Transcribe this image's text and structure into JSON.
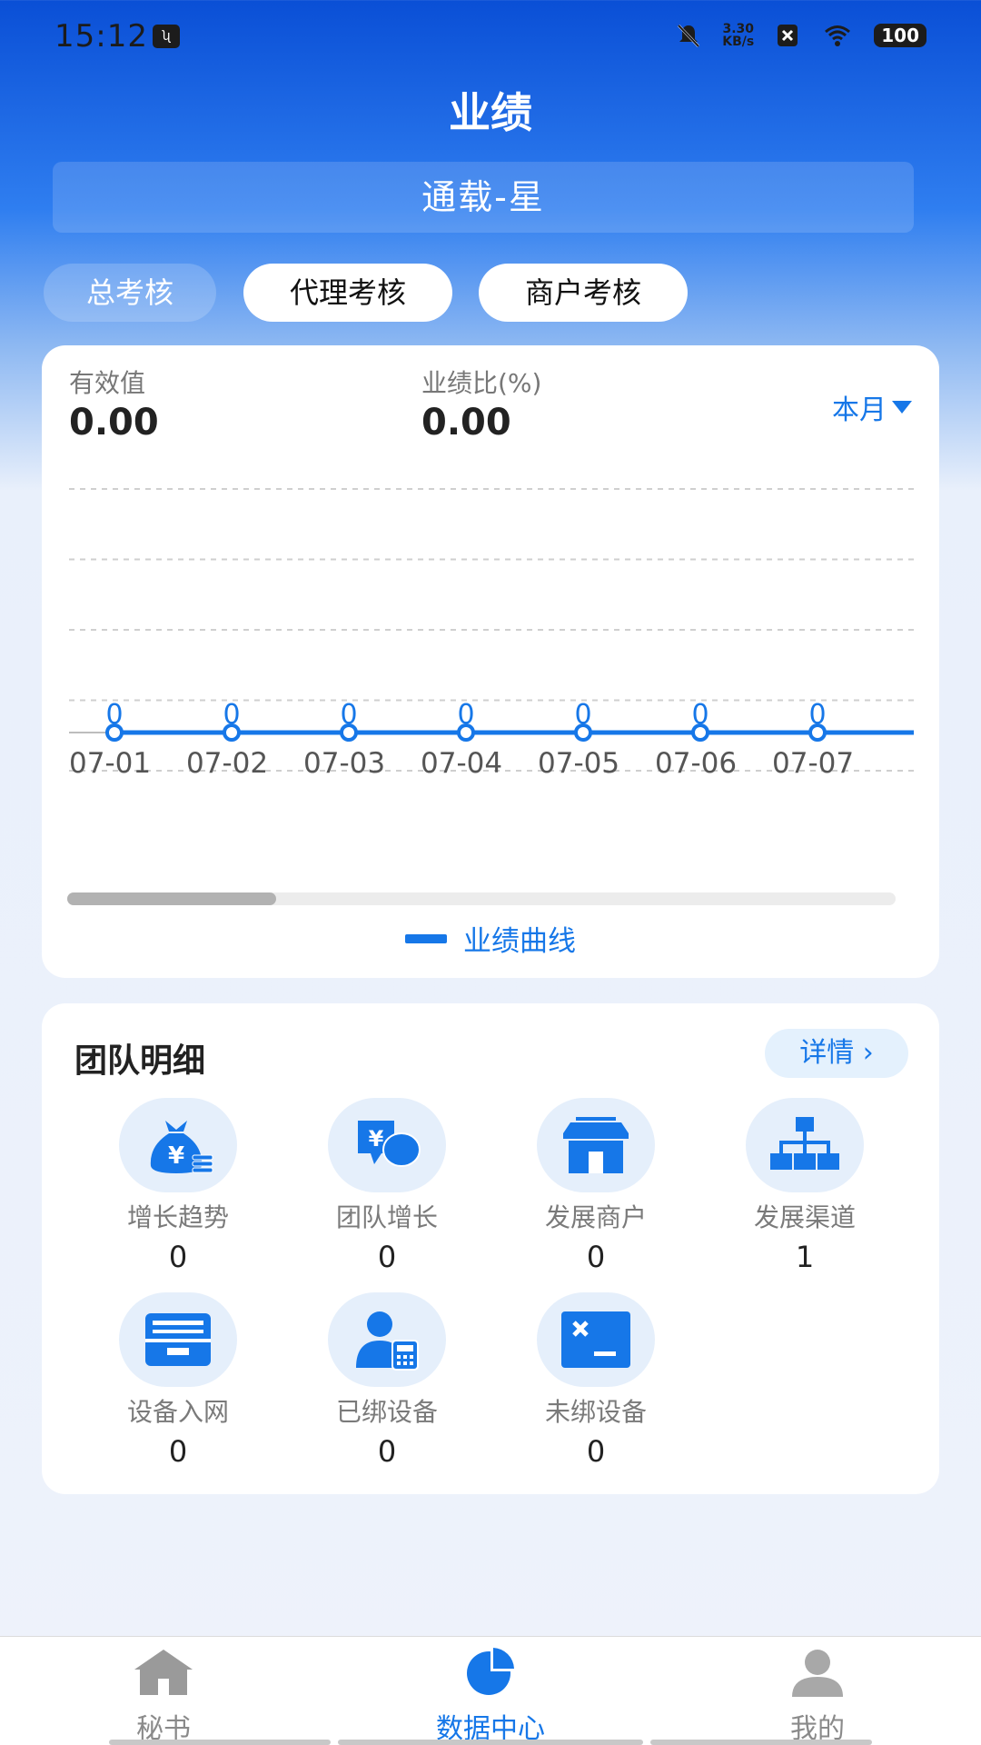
{
  "status_bar": {
    "time": "15:12",
    "net_speed_value": "3.30",
    "net_speed_unit": "KB/s",
    "battery": "100"
  },
  "header": {
    "title": "业绩",
    "agent_name": "通载-星"
  },
  "tabs": [
    {
      "label": "总考核",
      "active": true
    },
    {
      "label": "代理考核",
      "active": false
    },
    {
      "label": "商户考核",
      "active": false
    }
  ],
  "summary": {
    "metric1_label": "有效值",
    "metric1_value": "0.00",
    "metric2_label": "业绩比(%)",
    "metric2_value": "0.00",
    "period_label": "本月"
  },
  "chart_data": {
    "type": "line",
    "categories": [
      "07-01",
      "07-02",
      "07-03",
      "07-04",
      "07-05",
      "07-06",
      "07-07"
    ],
    "series": [
      {
        "name": "业绩曲线",
        "values": [
          0,
          0,
          0,
          0,
          0,
          0,
          0
        ]
      }
    ],
    "grid": true,
    "legend_position": "bottom",
    "line_color": "#1677e8"
  },
  "team": {
    "title": "团队明细",
    "detail_label": "详情",
    "items": [
      {
        "label": "增长趋势",
        "value": "0",
        "icon": "money-bag-icon"
      },
      {
        "label": "团队增长",
        "value": "0",
        "icon": "yuan-chat-icon"
      },
      {
        "label": "发展商户",
        "value": "0",
        "icon": "store-icon"
      },
      {
        "label": "发展渠道",
        "value": "1",
        "icon": "org-chart-icon"
      },
      {
        "label": "设备入网",
        "value": "0",
        "icon": "inbox-icon"
      },
      {
        "label": "已绑设备",
        "value": "0",
        "icon": "user-pos-icon"
      },
      {
        "label": "未绑设备",
        "value": "0",
        "icon": "terminal-unbind-icon"
      }
    ]
  },
  "nav": [
    {
      "label": "秘书",
      "icon": "home-icon",
      "active": false
    },
    {
      "label": "数据中心",
      "icon": "pie-chart-icon",
      "active": true
    },
    {
      "label": "我的",
      "icon": "user-icon",
      "active": false
    }
  ],
  "colors": {
    "accent": "#1677e8",
    "icon_bg": "#e5effb",
    "nav_inactive": "#9a9a9a"
  }
}
